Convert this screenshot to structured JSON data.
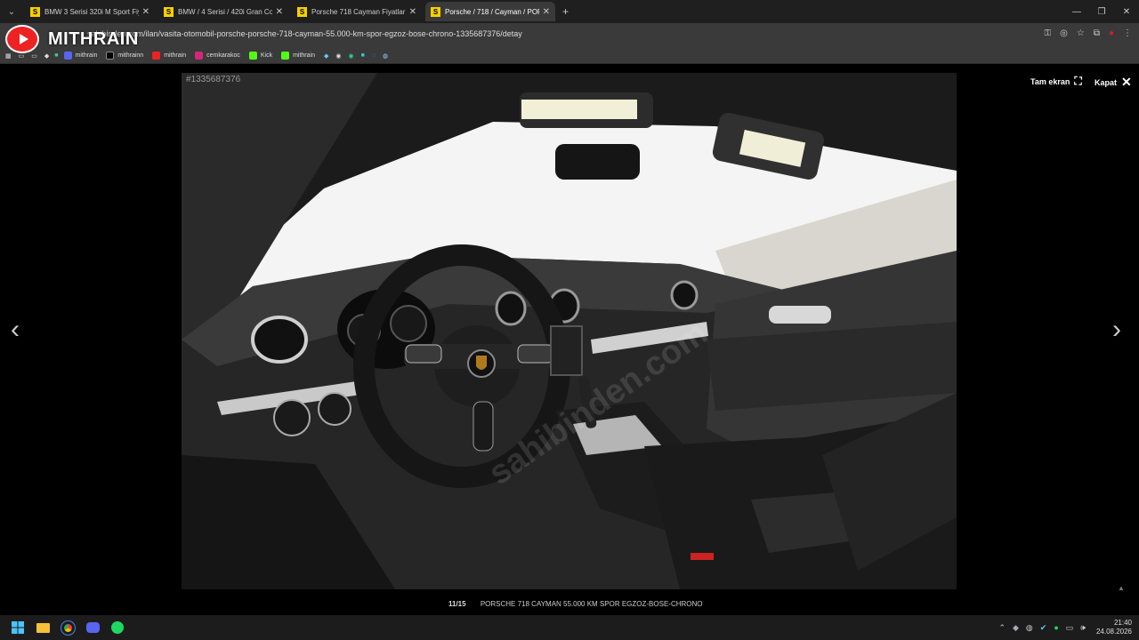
{
  "browser": {
    "tabs": [
      {
        "title": "BMW 3 Serisi 320i M Sport Fiya",
        "active": false
      },
      {
        "title": "BMW / 4 Serisi / 420i Gran Cou",
        "active": false
      },
      {
        "title": "Porsche 718 Cayman Fiyatları &",
        "active": false
      },
      {
        "title": "Porsche / 718 / Cayman / PORS",
        "active": true
      }
    ],
    "url": "sahibinden.com/ilan/vasita-otomobil-porsche-porsche-718-cayman-55.000-km-spor-egzoz-bose-chrono-1335687376/detay",
    "bookmarks": [
      "mithrain",
      "mithrainn",
      "mithrain",
      "cemkarakoc",
      "Kick",
      "mithrain"
    ]
  },
  "overlay": {
    "logo_text": "MITHRAIN"
  },
  "viewer": {
    "listing_id": "#1335687376",
    "fullscreen_label": "Tam ekran",
    "close_label": "Kapat",
    "counter": "11/15",
    "caption": "PORSCHE 718 CAYMAN 55.000 KM SPOR EGZOZ-BOSE-CHRONO"
  },
  "taskbar": {
    "time": "21:40",
    "date": "24.08.2026"
  }
}
